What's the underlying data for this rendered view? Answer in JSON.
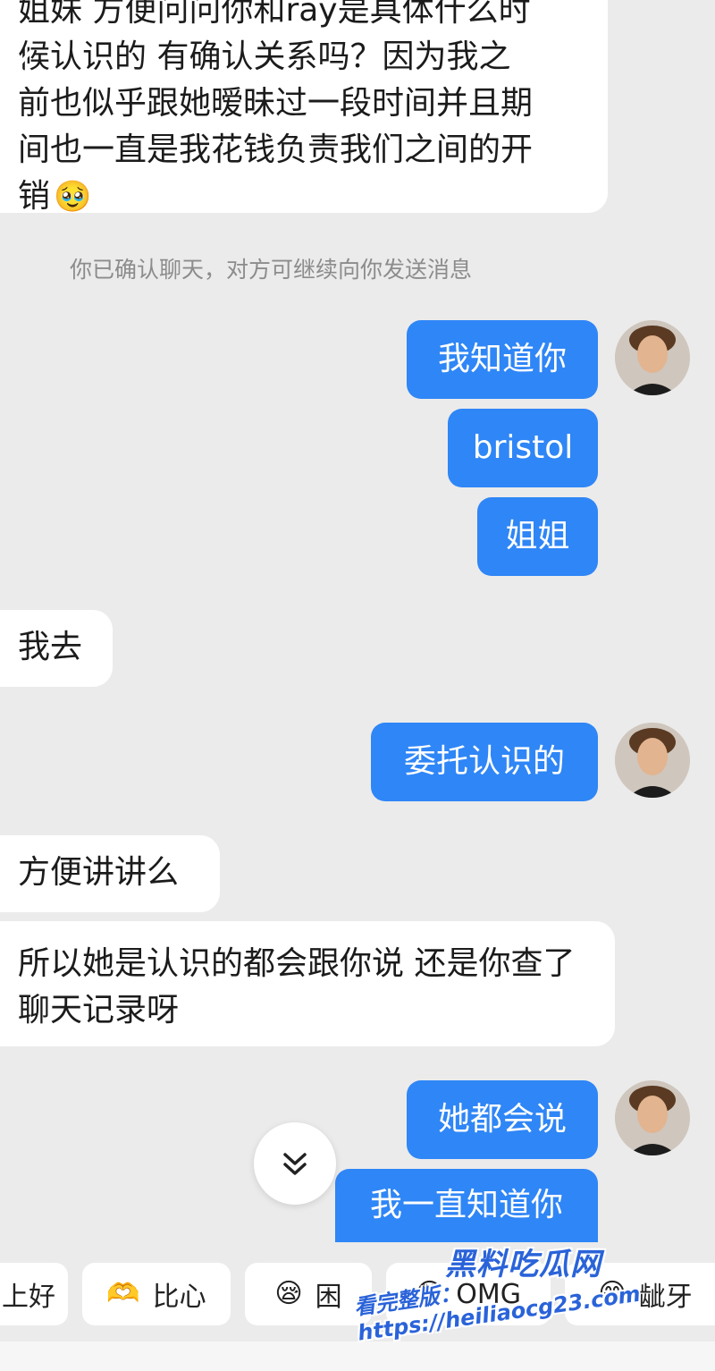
{
  "top_message": {
    "line1": "姐妹 方便问问你和ray是具体什么时",
    "line2": "候认识的 有确认关系吗？因为我之",
    "line3": "前也似乎跟她暧昧过一段时间并且期",
    "line4": "间也一直是我花钱负责我们之间的开",
    "line5": "销"
  },
  "system_notice": "你已确认聊天，对方可继续向你发送消息",
  "messages": [
    {
      "side": "out",
      "text": "我知道你"
    },
    {
      "side": "out",
      "text": "bristol"
    },
    {
      "side": "out",
      "text": "姐姐"
    },
    {
      "side": "in",
      "text": "我去"
    },
    {
      "side": "out",
      "text": "委托认识的"
    },
    {
      "side": "in",
      "text": "方便讲讲么"
    },
    {
      "side": "in",
      "text": "所以她是认识的都会跟你说 还是你查了聊天记录呀"
    },
    {
      "side": "out",
      "text": "她都会说"
    },
    {
      "side": "out",
      "text": "我一直知道你"
    }
  ],
  "quick_replies": [
    {
      "label": "上好",
      "emoji": ""
    },
    {
      "label": "比心",
      "emoji": "🫶"
    },
    {
      "label": "困",
      "emoji": "😪"
    },
    {
      "label": "OMG",
      "emoji": "😳"
    },
    {
      "label": "龇牙",
      "emoji": "😁"
    }
  ],
  "watermark": {
    "title": "黑料吃瓜网",
    "url": "看完整版：https://heiliaocg23.com"
  },
  "icons": {
    "back": "chevron-left-icon",
    "scroll_down": "double-chevron-down-icon",
    "crying_emoji": "pleading-face-icon"
  },
  "colors": {
    "outgoing_bubble": "#2f86f6",
    "incoming_bubble": "#ffffff",
    "background": "#ebebeb"
  }
}
